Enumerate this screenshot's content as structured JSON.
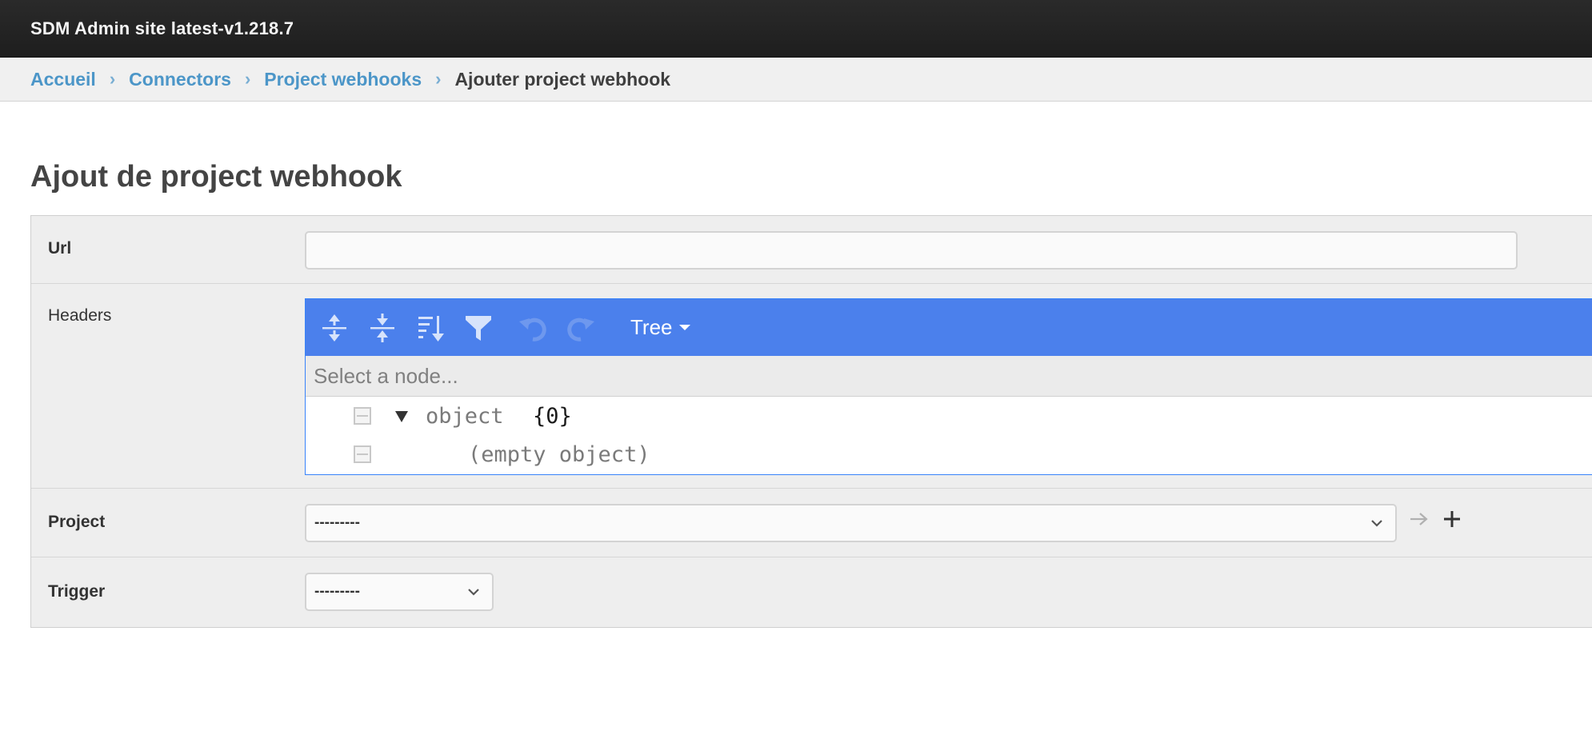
{
  "header": {
    "site_title": "SDM Admin site latest-v1.218.7"
  },
  "breadcrumbs": {
    "items": [
      "Accueil",
      "Connectors",
      "Project webhooks"
    ],
    "current": "Ajouter project webhook",
    "separator": "›"
  },
  "page": {
    "title": "Ajout de project webhook"
  },
  "form": {
    "url": {
      "label": "Url",
      "value": ""
    },
    "headers": {
      "label": "Headers",
      "editor": {
        "toolbar_icons": [
          "expand-all-icon",
          "collapse-all-icon",
          "sort-icon",
          "filter-icon",
          "undo-icon",
          "redo-icon"
        ],
        "mode_label": "Tree",
        "navbar_placeholder": "Select a node...",
        "root_type": "object",
        "root_count": "{0}",
        "empty_label": "(empty object)"
      }
    },
    "project": {
      "label": "Project",
      "selected": "---------"
    },
    "trigger": {
      "label": "Trigger",
      "selected": "---------"
    }
  },
  "colors": {
    "header_bg": "#222222",
    "breadcrumb_link": "#4c96c8",
    "editor_toolbar": "#4b80ec",
    "editor_border": "#3883fa",
    "panel_bg": "#eeeeee"
  }
}
